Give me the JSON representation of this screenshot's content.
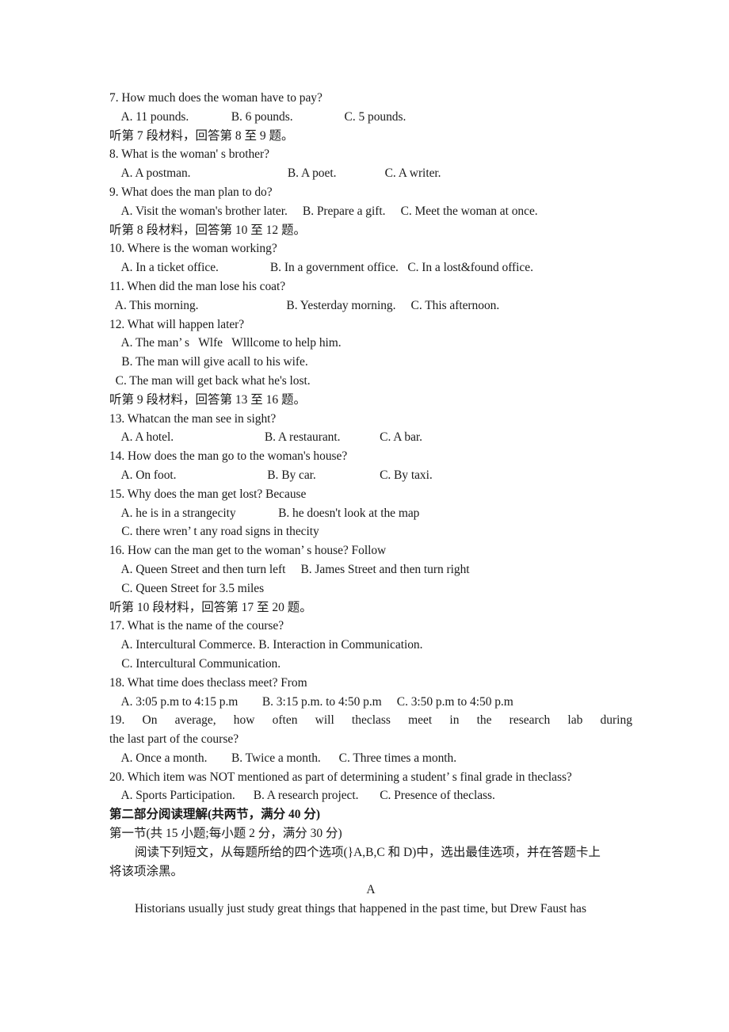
{
  "document": {
    "type": "exam-paper",
    "language": "zh-en",
    "background_color": "#ffffff",
    "text_color": "#1a1a1a"
  },
  "listening": {
    "q7": {
      "stem": "7. How much does the woman have to pay?",
      "options": "    A. 11 pounds.              B. 6 pounds.                 C. 5 pounds."
    },
    "direction7": "听第 7 段材料，回答第 8 至 9 题。",
    "q8": {
      "stem": "8. What is the woman' s brother?",
      "options": "    A. A postman.                                B. A poet.                C. A writer."
    },
    "q9": {
      "stem": "9. What does the man plan to do?",
      "options": "    A. Visit the woman's brother later.     B. Prepare a gift.     C. Meet the woman at once."
    },
    "direction8": "听第 8 段材料，回答第 10 至 12 题。",
    "q10": {
      "stem": "10. Where is the woman working?",
      "options": "    A. In a ticket office.                 B. In a government office.   C. In a lost&found office."
    },
    "q11": {
      "stem": "11. When did the man lose his coat?",
      "options": "  A. This morning.                             B. Yesterday morning.     C. This afternoon."
    },
    "q12": {
      "stem": "12. What will happen later?",
      "option_a": "    A. The man’ s   Wlfe   Wlllcome to help him.",
      "option_b": "    B. The man will give acall to his wife.",
      "option_c": "  C. The man will get back what he's lost."
    },
    "direction9": "听第 9 段材料，回答第 13 至 16 题。",
    "q13": {
      "stem": "13. Whatcan the man see in sight?",
      "options": "    A. A hotel.                              B. A restaurant.             C. A bar."
    },
    "q14": {
      "stem": "14. How does the man go to the woman's house?",
      "options": "    A. On foot.                              B. By car.                     C. By taxi."
    },
    "q15": {
      "stem": "15. Why does the man get lost? Because",
      "option_ab": "    A. he is in a strangecity              B. he doesn't look at the map",
      "option_c": "    C. there wren’ t any road signs in thecity"
    },
    "q16": {
      "stem": "16. How can the man get to the woman’ s house? Follow",
      "option_ab": "    A. Queen Street and then turn left     B. James Street and then turn right",
      "option_c": "    C. Queen Street for 3.5 miles"
    },
    "direction10": "听第 10 段材料，回答第 17 至 20 题。",
    "q17": {
      "stem": "17. What is the name of the course?",
      "option_ab": "    A. Intercultural Commerce. B. Interaction in Communication.",
      "option_c": "    C. Intercultural Communication."
    },
    "q18": {
      "stem": "18. What time does theclass meet? From",
      "options": "    A. 3:05 p.m to 4:15 p.m        B. 3:15 p.m. to 4:50 p.m     C. 3:50 p.m to 4:50 p.m"
    },
    "q19": {
      "stem_line1": "19. On average, how often will theclass meet in the research lab during",
      "stem_line2": "the last part of the course?",
      "options": "    A. Once a month.        B. Twice a month.      C. Three times a month."
    },
    "q20": {
      "stem": "20. Which item was NOT mentioned as part of determining a student’ s final grade in theclass?",
      "options": "    A. Sports Participation.      B. A research project.       C. Presence of theclass."
    }
  },
  "reading": {
    "part_title": "第二部分阅读理解(共两节，满分 40 分)",
    "section_title": "第一节(共 15 小题;每小题 2 分，满分 30 分)",
    "instruction_line1": "阅读下列短文，从每题所给的四个选项(}A,B,C 和 D)中，选出最佳选项，并在答题卡上",
    "instruction_line2": "将该项涂黑。",
    "passage_label": "A",
    "passage_line1": "Historians usually just study great things that happened in the past time, but Drew Faust has"
  }
}
